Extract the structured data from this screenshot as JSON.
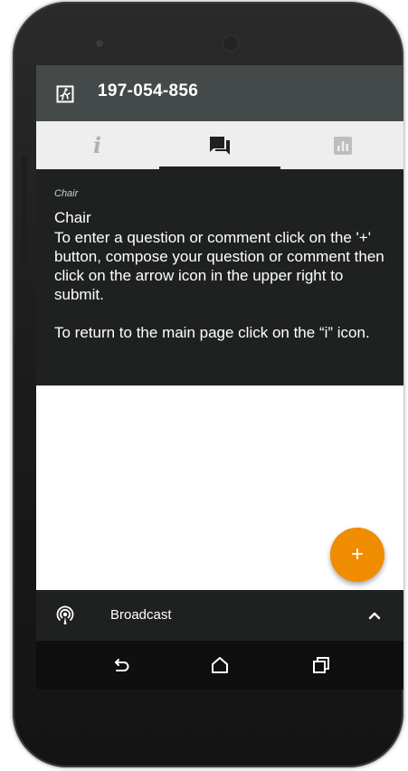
{
  "app_bar": {
    "meeting_id": "197-054-856",
    "exit_icon": "exit-door-icon"
  },
  "tabs": [
    {
      "name": "info",
      "glyph": "i",
      "selected": false
    },
    {
      "name": "chat",
      "icon": "chat-icon",
      "selected": true
    },
    {
      "name": "poll",
      "icon": "poll-chart-icon",
      "selected": false
    }
  ],
  "content": {
    "small_label": "Chair",
    "title": "Chair",
    "paragraph1": "To enter a question or comment click on the '+' button, compose your question or comment then click on the arrow icon in the upper right to submit.",
    "paragraph2": "To return to the main page click on the “i” icon."
  },
  "fab": {
    "label": "+",
    "color": "#f08c00"
  },
  "broadcast": {
    "label": "Broadcast",
    "icon": "broadcast-icon",
    "chevron": "chevron-up-icon"
  },
  "nav": {
    "back": "back-icon",
    "home": "home-icon",
    "recents": "recents-icon"
  },
  "colors": {
    "app_bar": "#444a4a",
    "tab_bar": "#eeeeee",
    "dark_panel": "#1f2121",
    "accent": "#f08c00"
  }
}
